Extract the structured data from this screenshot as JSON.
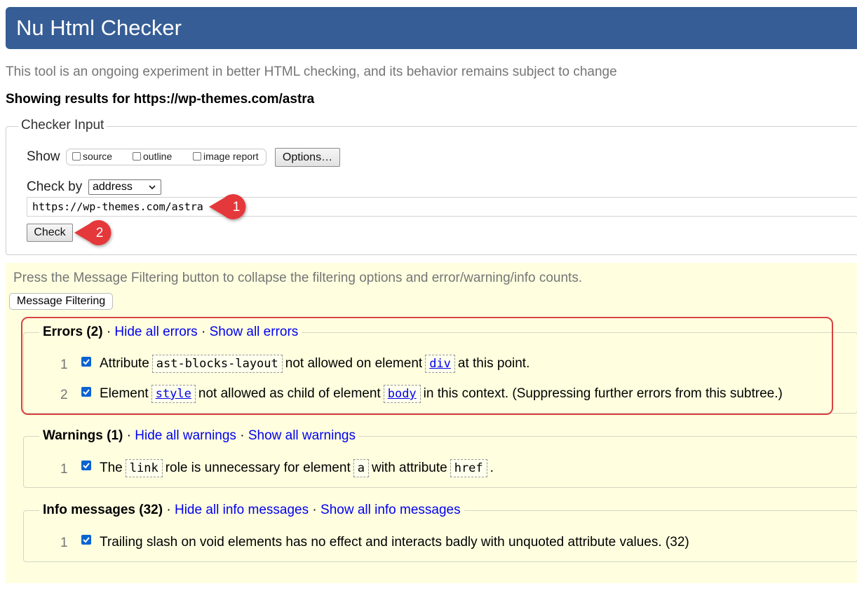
{
  "header": {
    "title": "Nu Html Checker"
  },
  "intro": "This tool is an ongoing experiment in better HTML checking, and its behavior remains subject to change",
  "showing_results": "Showing results for https://wp-themes.com/astra",
  "checker_input": {
    "legend": "Checker Input",
    "show_label": "Show",
    "show_options": [
      "source",
      "outline",
      "image report"
    ],
    "options_button": "Options…",
    "check_by_label": "Check by",
    "check_by_value": "address",
    "url_value": "https://wp-themes.com/astra",
    "check_button": "Check"
  },
  "callouts": [
    "1",
    "2"
  ],
  "filtering": {
    "hint": "Press the Message Filtering button to collapse the filtering options and error/warning/info counts.",
    "button": "Message Filtering"
  },
  "errors": {
    "title": "Errors (2)",
    "sep": "·",
    "hide": "Hide all errors",
    "show": "Show all errors",
    "items": [
      {
        "num": "1",
        "pre": "Attribute",
        "code1": "ast-blocks-layout",
        "mid": "not allowed on element",
        "code2": "div",
        "post": "at this point."
      },
      {
        "num": "2",
        "pre": "Element",
        "code1": "style",
        "mid": "not allowed as child of element",
        "code2": "body",
        "post": "in this context. (Suppressing further errors from this subtree.)"
      }
    ]
  },
  "warnings": {
    "title": "Warnings (1)",
    "sep": "·",
    "hide": "Hide all warnings",
    "show": "Show all warnings",
    "item": {
      "num": "1",
      "pre": "The",
      "code1": "link",
      "mid1": "role is unnecessary for element",
      "code2": "a",
      "mid2": "with attribute",
      "code3": "href",
      "post": "."
    }
  },
  "info": {
    "title": "Info messages (32)",
    "sep": "·",
    "hide": "Hide all info messages",
    "show": "Show all info messages",
    "item": {
      "num": "1",
      "text": "Trailing slash on void elements has no effect and interacts badly with unquoted attribute values. (32)"
    }
  },
  "colors": {
    "header": "#365d95",
    "filter_bg": "#ffffe0",
    "link": "#0000ee",
    "callout": "#e5393b",
    "highlight": "#d9423f"
  }
}
